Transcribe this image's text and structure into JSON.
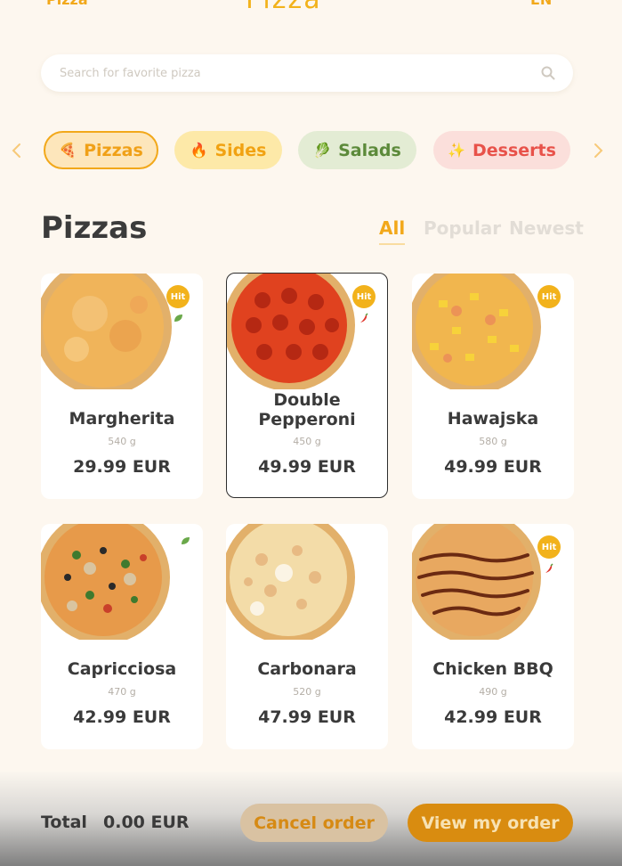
{
  "header": {
    "left_label": "Pizza",
    "logo": "Pizza",
    "right_label": "EN"
  },
  "search": {
    "placeholder": "Search for favorite pizza",
    "icon": "search-icon"
  },
  "categories": [
    {
      "label": "Pizzas",
      "emoji": "🍕",
      "active": true
    },
    {
      "label": "Sides",
      "emoji": "🔥",
      "active": false
    },
    {
      "label": "Salads",
      "emoji": "🥬",
      "active": false
    },
    {
      "label": "Desserts",
      "emoji": "✨",
      "active": false
    }
  ],
  "section": {
    "title": "Pizzas",
    "filters": [
      "All",
      "Popular",
      "Newest"
    ],
    "active_filter": "All"
  },
  "products": [
    {
      "name": "Margherita",
      "weight": "540 g",
      "price": "29.99 EUR",
      "hit": "Hit",
      "tag": "vegetarian-leaf-icon"
    },
    {
      "name": "Double Pepperoni",
      "weight": "450 g",
      "price": "49.99 EUR",
      "hit": "Hit",
      "tag": "spicy-chili-icon",
      "selected": true
    },
    {
      "name": "Hawajska",
      "weight": "580 g",
      "price": "49.99 EUR",
      "hit": "Hit"
    },
    {
      "name": "Capricciosa",
      "weight": "470 g",
      "price": "42.99 EUR",
      "tag": "vegetarian-leaf-icon"
    },
    {
      "name": "Carbonara",
      "weight": "520 g",
      "price": "47.99 EUR"
    },
    {
      "name": "Chicken BBQ",
      "weight": "490 g",
      "price": "42.99 EUR",
      "hit": "Hit",
      "tag": "spicy-chili-icon"
    }
  ],
  "footer": {
    "total_label": "Total",
    "total_value": "0.00 EUR",
    "cancel_label": "Cancel order",
    "view_label": "View my order"
  },
  "colors": {
    "accent": "#f2a81a",
    "background": "#fdf7ef",
    "hit_badge": "#f2b21b",
    "salads": "#5c8a3a",
    "desserts": "#e8524a"
  }
}
